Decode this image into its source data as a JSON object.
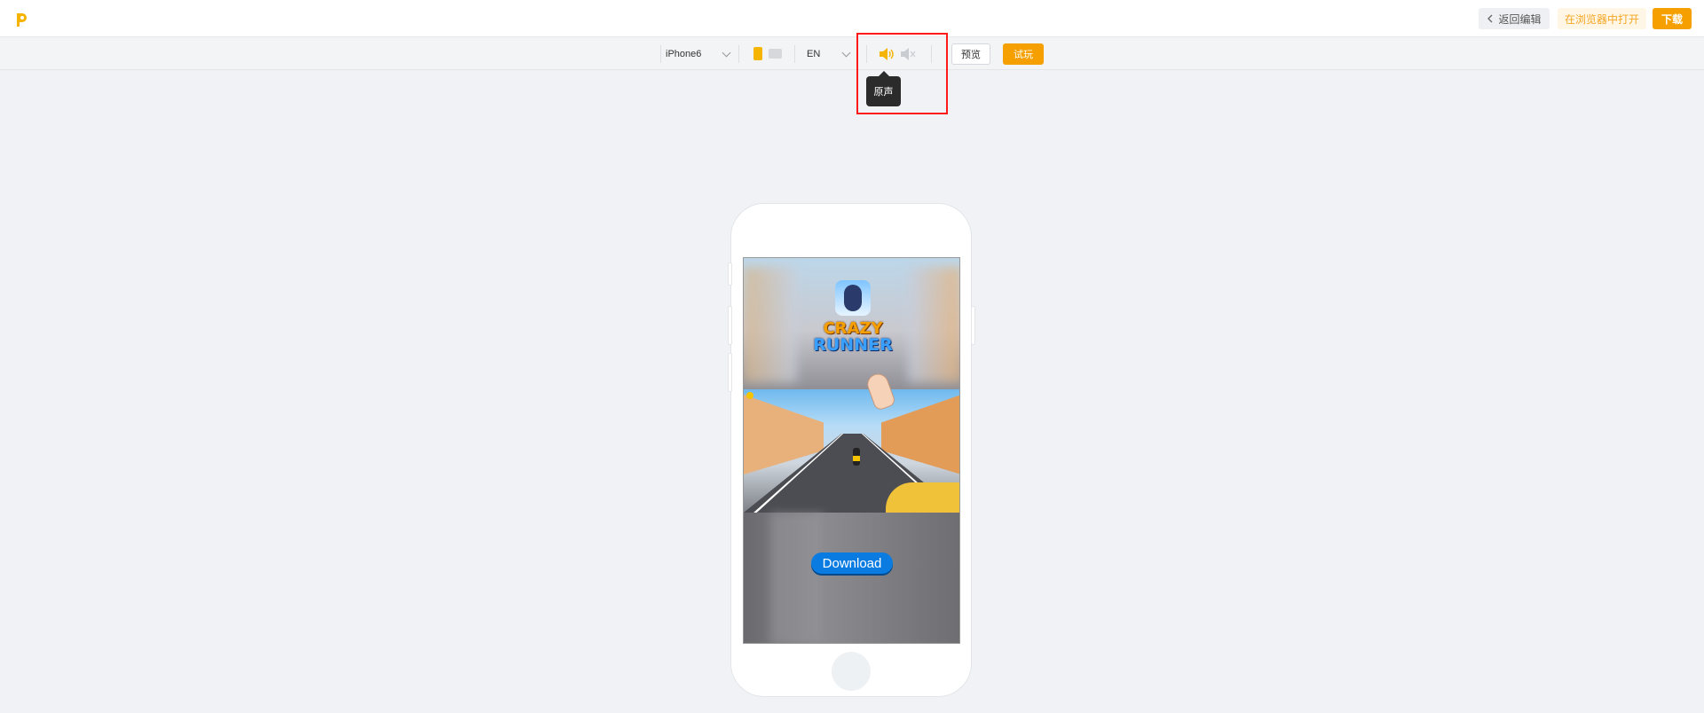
{
  "topbar": {
    "back_label": "返回编辑",
    "open_in_browser_label": "在浏览器中打开",
    "download_label": "下载"
  },
  "toolbar": {
    "device": "iPhone6",
    "language": "EN",
    "preview_label": "预览",
    "play_label": "试玩",
    "icons": [
      "chevron-down-icon",
      "portrait-icon",
      "landscape-icon",
      "sound-on-icon",
      "sound-off-icon"
    ]
  },
  "tooltip": {
    "text": "原声"
  },
  "phone": {
    "game": {
      "title_line1": "CRAZY",
      "title_line2": "RUNNER",
      "cta_label": "Download"
    }
  },
  "colors": {
    "accent": "#f5a000",
    "highlight": "#ff1a1a",
    "cta": "#0a7be0"
  }
}
